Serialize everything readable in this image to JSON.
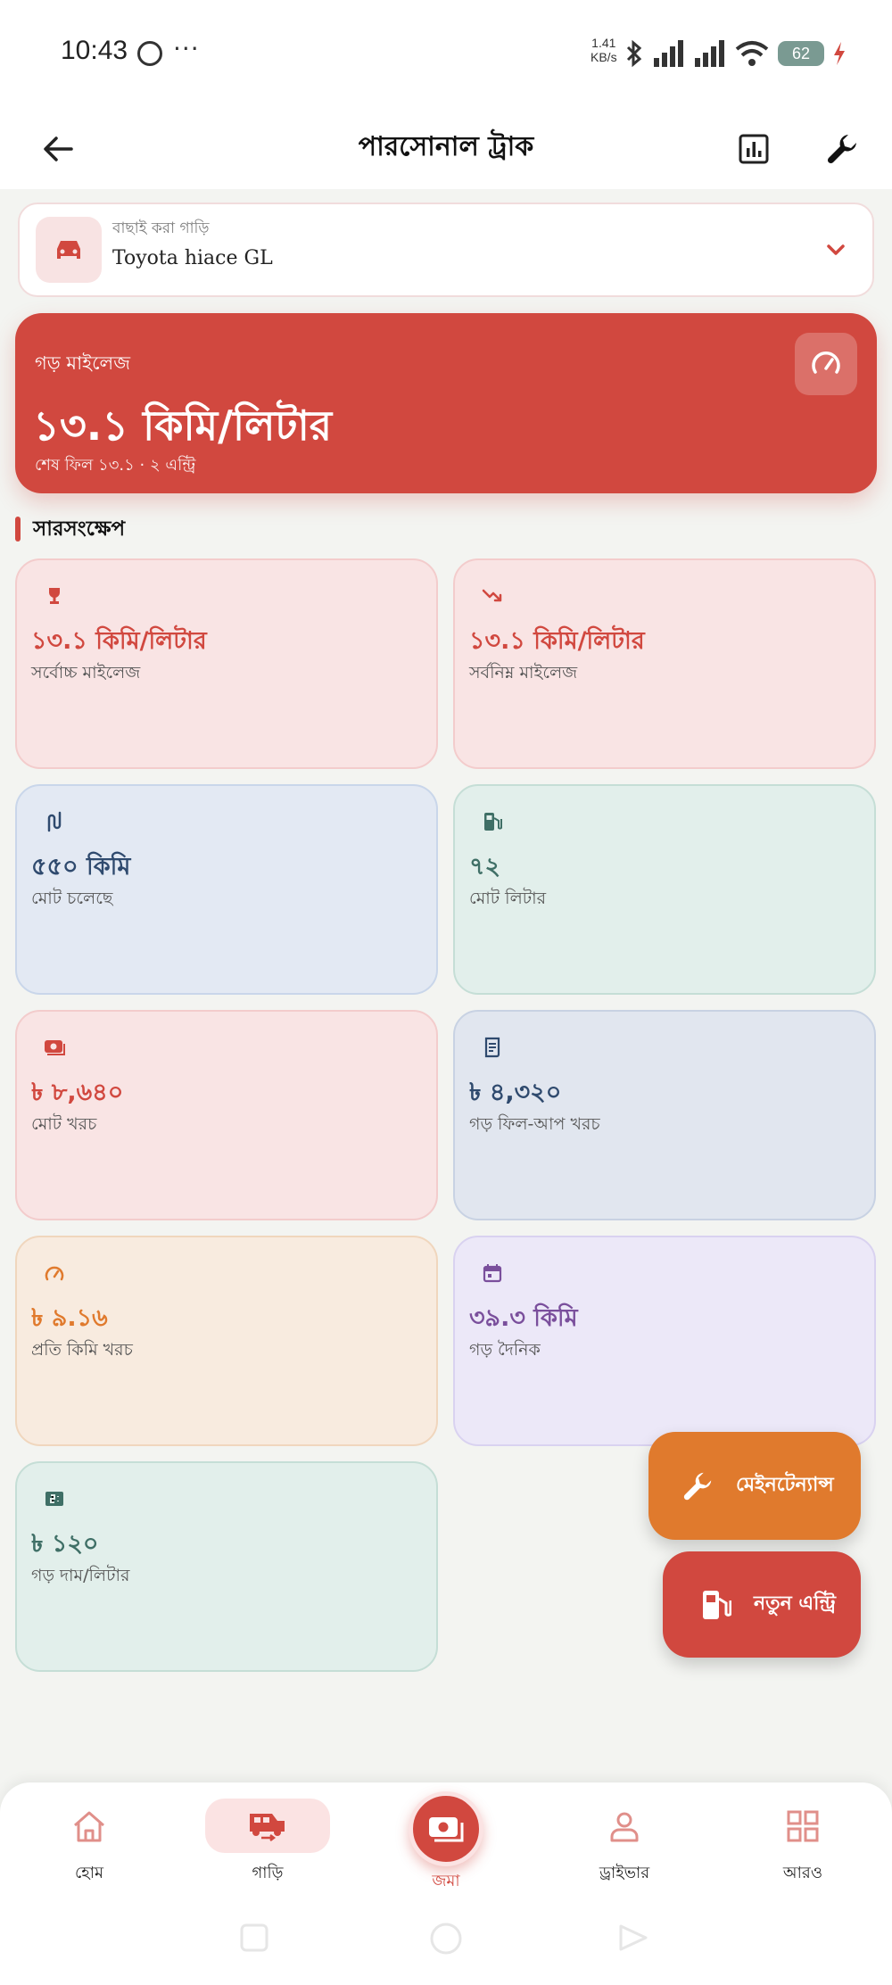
{
  "status_bar": {
    "time": "10:43",
    "more": "···",
    "speed_top": "1.41",
    "speed_bottom": "KB/s",
    "battery": "62",
    "icons": [
      "whatsapp-icon",
      "bluetooth-icon",
      "signal-icon",
      "wifi-icon",
      "battery-icon",
      "charging-icon"
    ]
  },
  "app_bar": {
    "title": "পারসোনাল ট্রাক",
    "back_icon": "arrow-left-icon",
    "actions": [
      "bar-chart-icon",
      "wrench-icon"
    ]
  },
  "vehicle_selector": {
    "caption": "বাছাই করা গাড়ি",
    "name": "Toyota hiace GL",
    "icon": "car-icon",
    "expand_icon": "chevron-down-icon"
  },
  "mileage_card": {
    "label": "গড় মাইলেজ",
    "value": "১৩.১ কিমি/লিটার",
    "subtext": "শেষ ফিল ১৩.১ · ২ এন্ট্রি",
    "icon": "speedometer-icon",
    "color": "#d1483f"
  },
  "summary": {
    "title": "সারসংক্ষেপ",
    "stats": [
      {
        "value": "১৩.১ কিমি/লিটার",
        "label": "সর্বোচ্চ মাইলেজ",
        "icon": "trophy-icon",
        "bg": "#f9e4e4",
        "border": "#f3cccc",
        "color": "#d1483f"
      },
      {
        "value": "১৩.১ কিমি/লিটার",
        "label": "সর্বনিম্ন মাইলেজ",
        "icon": "trending-down-icon",
        "bg": "#f9e4e4",
        "border": "#f3cccc",
        "color": "#d1483f"
      },
      {
        "value": "৫৫০ কিমি",
        "label": "মোট চলেছে",
        "icon": "route-icon",
        "bg": "#e3e9f3",
        "border": "#c9d6ea",
        "color": "#2f4a6e"
      },
      {
        "value": "৭২",
        "label": "মোট লিটার",
        "icon": "fuel-pump-icon",
        "bg": "#e2efeb",
        "border": "#c5ded6",
        "color": "#3f6f66"
      },
      {
        "value": "৳ ৮,৬৪০",
        "label": "মোট খরচ",
        "icon": "cash-icon",
        "bg": "#f9e4e4",
        "border": "#f3cccc",
        "color": "#d1483f"
      },
      {
        "value": "৳ ৪,৩২০",
        "label": "গড় ফিল-আপ খরচ",
        "icon": "receipt-icon",
        "bg": "#e1e6ef",
        "border": "#c8d2e3",
        "color": "#2f4a6e"
      },
      {
        "value": "৳ ৯.১৬",
        "label": "প্রতি কিমি খরচ",
        "icon": "gauge-icon",
        "bg": "#f8ebdf",
        "border": "#f0d6bd",
        "color": "#e07a2d"
      },
      {
        "value": "৩৯.৩ কিমি",
        "label": "গড় দৈনিক",
        "icon": "calendar-icon",
        "bg": "#ece8f8",
        "border": "#d9d2f0",
        "color": "#7a4f9c"
      },
      {
        "value": "৳ ১২০",
        "label": "গড় দাম/লিটার",
        "icon": "price-tag-icon",
        "bg": "#e2efeb",
        "border": "#c5ded6",
        "color": "#3f6f66"
      }
    ]
  },
  "fabs": {
    "maintenance": {
      "label": "মেইনটেন্যান্স",
      "icon": "wrench-icon",
      "color": "#e07a2d"
    },
    "new_entry": {
      "label": "নতুন এন্ট্রি",
      "icon": "fuel-pump-icon",
      "color": "#d1483f"
    }
  },
  "bottom_nav": {
    "items": [
      {
        "label": "হোম",
        "icon": "home-icon"
      },
      {
        "label": "গাড়ি",
        "icon": "vehicle-transfer-icon",
        "active": true
      },
      {
        "label": "জমা",
        "icon": "cash-icon"
      },
      {
        "label": "ড্রাইভার",
        "icon": "person-icon"
      },
      {
        "label": "আরও",
        "icon": "grid-icon"
      }
    ]
  }
}
